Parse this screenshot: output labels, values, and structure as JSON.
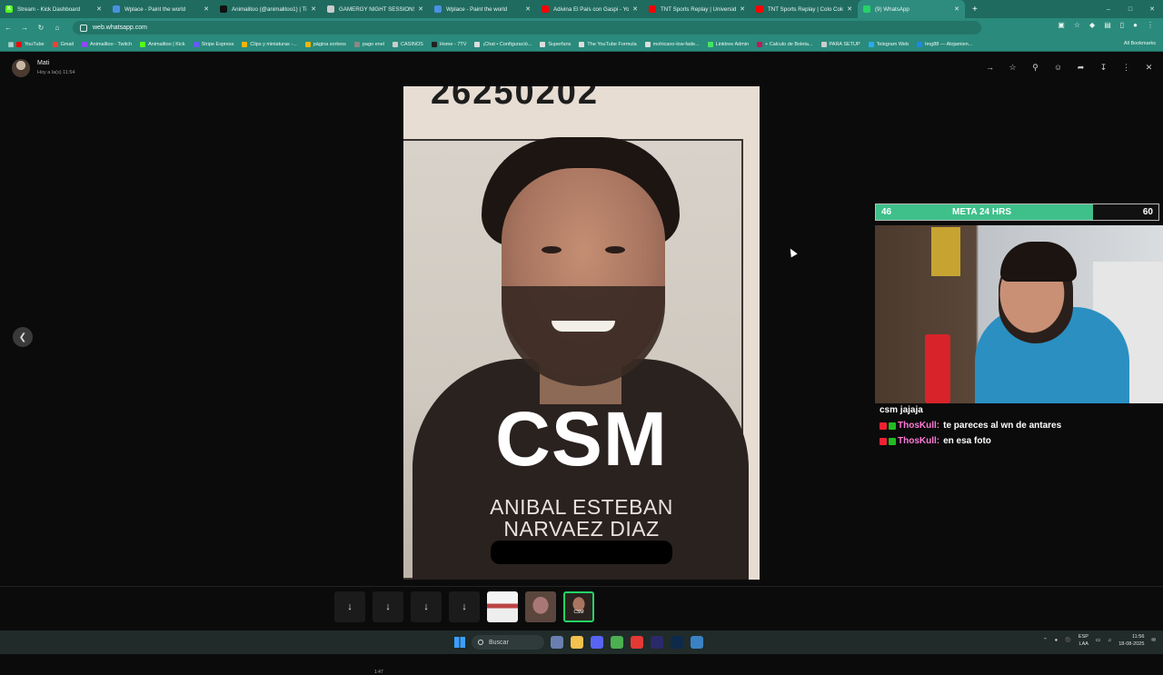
{
  "browser": {
    "tabs": [
      {
        "title": "Stream - Kick Dashboard",
        "icon": "kick-icon",
        "color": "#53fc18",
        "glyph": "K"
      },
      {
        "title": "Wplace - Paint the world",
        "icon": "wplace-icon",
        "color": "#4a90e2",
        "glyph": ""
      },
      {
        "title": "Animalitoo (@animalitoo1) | Ti",
        "icon": "tiktok-icon",
        "color": "#111111",
        "glyph": ""
      },
      {
        "title": "GAMERGY NIGHT SESSIONS -",
        "icon": "page-icon",
        "color": "#cccccc",
        "glyph": ""
      },
      {
        "title": "Wplace - Paint the world",
        "icon": "wplace-icon",
        "color": "#4a90e2",
        "glyph": ""
      },
      {
        "title": "Adivina El País con Gaspi - You",
        "icon": "youtube-icon",
        "color": "#ff0000",
        "glyph": ""
      },
      {
        "title": "TNT Sports Replay | Universidac",
        "icon": "youtube-icon",
        "color": "#ff0000",
        "glyph": ""
      },
      {
        "title": "TNT Sports Replay | Colo Colo",
        "icon": "youtube-icon",
        "color": "#ff0000",
        "glyph": ""
      },
      {
        "title": "(9) WhatsApp",
        "icon": "whatsapp-icon",
        "color": "#25d366",
        "glyph": "",
        "active": true
      }
    ],
    "url": "web.whatsapp.com",
    "bookmarks": [
      {
        "label": "YouTube",
        "color": "#ff0000"
      },
      {
        "label": "Gmail",
        "color": "#ea4335"
      },
      {
        "label": "Animalitoo - Twitch",
        "color": "#9146ff"
      },
      {
        "label": "Animalitoo | Kick",
        "color": "#53fc18"
      },
      {
        "label": "Stripe Express",
        "color": "#635bff"
      },
      {
        "label": "Clips y miniaturas -...",
        "color": "#f4b400"
      },
      {
        "label": "página sorteos",
        "color": "#f4b400"
      },
      {
        "label": "pago enel",
        "color": "#888888"
      },
      {
        "label": "CASINOS",
        "color": "#cccccc"
      },
      {
        "label": "Home - 7TV",
        "color": "#222222"
      },
      {
        "label": "¡Chat • Configuració...",
        "color": "#dddddd"
      },
      {
        "label": "Superfans",
        "color": "#dddddd"
      },
      {
        "label": "The YouTube Formula",
        "color": "#dddddd"
      },
      {
        "label": "mohicano-low-fade...",
        "color": "#dddddd"
      },
      {
        "label": "Linktree Admin",
        "color": "#43e660"
      },
      {
        "label": "+ Calculo de Boleta...",
        "color": "#c2185b"
      },
      {
        "label": "PARA SETUP",
        "color": "#cccccc"
      },
      {
        "label": "Telegram Web",
        "color": "#2aabee"
      },
      {
        "label": "Img88 — Alojamien...",
        "color": "#1e88e5"
      }
    ],
    "all_bookmarks": "All Bookmarks"
  },
  "viewer": {
    "contact_name": "Mati",
    "contact_status": "Hoy a la(s) 11:54",
    "photo": {
      "top_number": "26250202",
      "big_text": "CSM",
      "name_line1": "ANIBAL ESTEBAN",
      "name_line2": "NARVAEZ DIAZ"
    },
    "download_count": "1:47"
  },
  "stream_overlay": {
    "goal_current": "46",
    "goal_label": "META 24 HRS",
    "goal_target": "60",
    "goal_progress": 0.77,
    "chat": [
      {
        "user": "",
        "text": "csm jajaja"
      },
      {
        "user": "ThosKull:",
        "text": "te pareces al wn de antares"
      },
      {
        "user": "ThosKull:",
        "text": "en esa foto"
      }
    ]
  },
  "taskbar": {
    "search_placeholder": "Buscar",
    "lang_line1": "ESP",
    "lang_line2": "LAA",
    "time": "11:56",
    "date": "18-08-2025"
  }
}
